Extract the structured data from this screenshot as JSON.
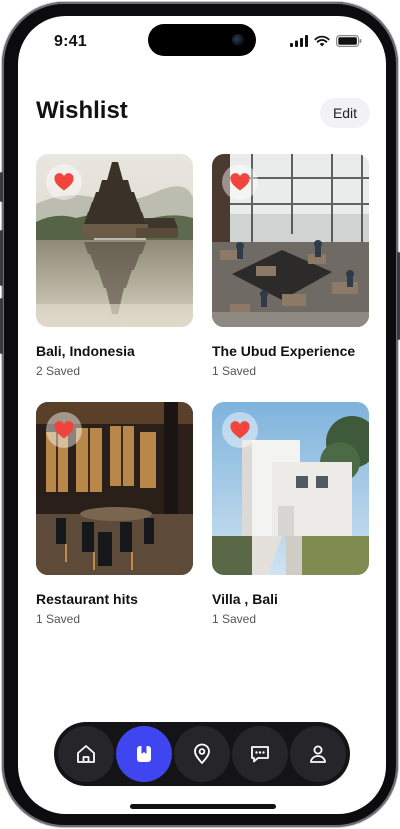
{
  "status_bar": {
    "time": "9:41"
  },
  "header": {
    "title": "Wishlist",
    "edit_label": "Edit"
  },
  "wishlists": [
    {
      "title": "Bali, Indonesia",
      "count": "2 Saved",
      "photo": "temple-lake"
    },
    {
      "title": "The Ubud Experience",
      "count": "1 Saved",
      "photo": "cafe-interior"
    },
    {
      "title": "Restaurant hits",
      "count": "1 Saved",
      "photo": "restaurant-interior"
    },
    {
      "title": "Villa , Bali",
      "count": "1 Saved",
      "photo": "white-villa"
    }
  ],
  "nav": {
    "items": [
      {
        "icon": "home-icon",
        "active": false
      },
      {
        "icon": "bookmark-icon",
        "active": true
      },
      {
        "icon": "location-pin-icon",
        "active": false
      },
      {
        "icon": "chat-icon",
        "active": false
      },
      {
        "icon": "profile-icon",
        "active": false
      }
    ]
  },
  "colors": {
    "accent": "#3f46f0",
    "heart": "#f0443c",
    "nav_bg": "#141416"
  }
}
